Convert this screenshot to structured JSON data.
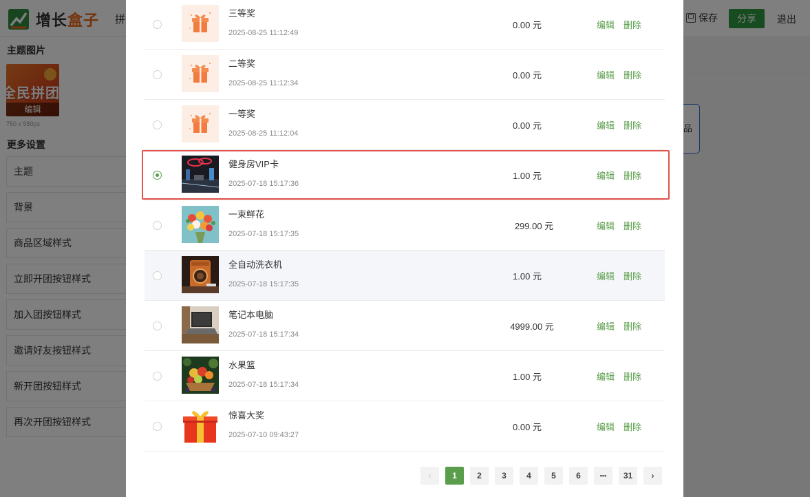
{
  "app": {
    "logo_text_a": "增长",
    "logo_text_b": "盒子",
    "top_menu_partial": "拼",
    "save_label": "保存",
    "share_label": "分享",
    "logout_label": "退出",
    "brand_green": "#2f9640",
    "accent_green": "#5a9e4b",
    "highlight_red": "#e0524a"
  },
  "left_panel": {
    "theme_image_title": "主题图片",
    "theme_image_text": "全民拼团",
    "theme_image_edit": "编辑",
    "theme_image_size": "750 x 580px",
    "more_settings_title": "更多设置",
    "settings": [
      "主题",
      "背景",
      "商品区域样式",
      "立即开团按钮样式",
      "加入团按钮样式",
      "邀请好友按钮样式",
      "新开团按钮样式",
      "再次开团按钮样式"
    ]
  },
  "center_partial_label": "品",
  "product_list": {
    "edit_label": "编辑",
    "delete_label": "删除",
    "selected_index": 3,
    "hovered_index": 5,
    "rows": [
      {
        "name": "三等奖",
        "date": "2025-08-25 11:12:49",
        "price": "0.00 元",
        "thumb": "gift-icon-light"
      },
      {
        "name": "二等奖",
        "date": "2025-08-25 11:12:34",
        "price": "0.00 元",
        "thumb": "gift-icon-light"
      },
      {
        "name": "一等奖",
        "date": "2025-08-25 11:12:04",
        "price": "0.00 元",
        "thumb": "gift-icon-light"
      },
      {
        "name": "健身房VIP卡",
        "date": "2025-07-18 15:17:36",
        "price": "1.00 元",
        "thumb": "gym-photo"
      },
      {
        "name": "一束鲜花",
        "date": "2025-07-18 15:17:35",
        "price": "299.00 元",
        "thumb": "flowers-photo"
      },
      {
        "name": "全自动洗衣机",
        "date": "2025-07-18 15:17:35",
        "price": "1.00 元",
        "thumb": "washing-machine-photo"
      },
      {
        "name": "笔记本电脑",
        "date": "2025-07-18 15:17:34",
        "price": "4999.00 元",
        "thumb": "laptop-photo"
      },
      {
        "name": "水果篮",
        "date": "2025-07-18 15:17:34",
        "price": "1.00 元",
        "thumb": "fruit-basket-photo"
      },
      {
        "name": "惊喜大奖",
        "date": "2025-07-10 09:43:27",
        "price": "0.00 元",
        "thumb": "gift-box-red"
      }
    ]
  },
  "pagination": {
    "prev": "‹",
    "pages": [
      "1",
      "2",
      "3",
      "4",
      "5",
      "6"
    ],
    "ellipsis": "•••",
    "last": "31",
    "next": "›",
    "current": "1"
  }
}
